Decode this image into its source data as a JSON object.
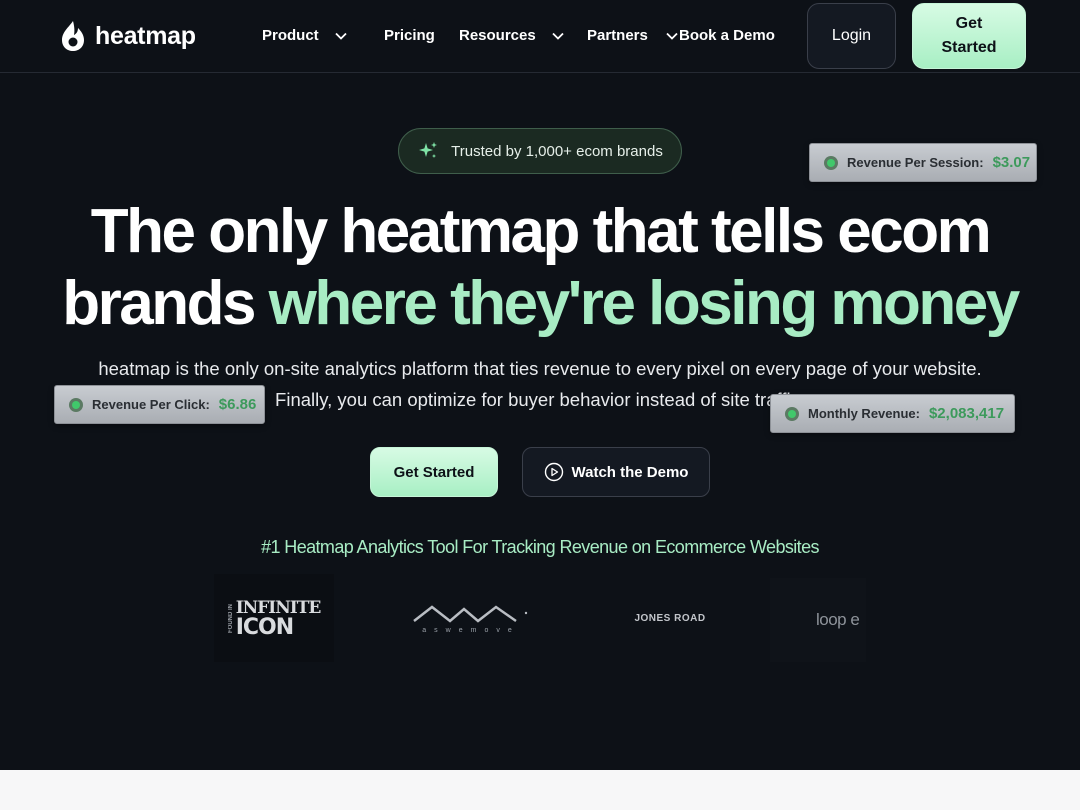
{
  "nav": {
    "brand": "heatmap",
    "items": [
      {
        "label": "Product",
        "has_dropdown": true
      },
      {
        "label": "Pricing",
        "has_dropdown": false
      },
      {
        "label": "Resources",
        "has_dropdown": true
      },
      {
        "label": "Partners",
        "has_dropdown": true
      },
      {
        "label": "Book a Demo",
        "has_dropdown": false
      }
    ],
    "login_label": "Login",
    "get_started_label": "Get Started"
  },
  "hero": {
    "trusted_text": "Trusted by 1,000+ ecom brands",
    "headline_line1": "The only heatmap that tells ecom",
    "headline_line2_plain": "brands",
    "headline_line2_accent": "where they're losing money",
    "subtext_line1": "heatmap is the only on-site analytics platform that ties revenue to every pixel on every page of your website.",
    "subtext_line2": "Finally, you can optimize for buyer behavior instead of site traffic.",
    "cta_primary": "Get Started",
    "cta_secondary": "Watch the Demo",
    "tagline": "#1 Heatmap Analytics Tool For Tracking Revenue on Ecommerce Websites"
  },
  "badges": [
    {
      "label": "Revenue Per Session:",
      "value": "$3.07"
    },
    {
      "label": "Revenue Per Click:",
      "value": "$6.86"
    },
    {
      "label": "Monthly Revenue:",
      "value": "$2,083,417"
    }
  ],
  "logos": {
    "infinite_icon_top": "INFINITE",
    "infinite_icon_bottom": "ICON",
    "infinite_icon_side": "FOUND IN",
    "aswemove": "aswemove",
    "jones_road": "JONES ROAD",
    "loop": "loop e"
  },
  "colors": {
    "background": "#0d1117",
    "accent_green": "#a8ecc4",
    "badge_value": "#3d9a5c",
    "button_gradient_top": "#d7fbe4",
    "button_gradient_bottom": "#a8efc4"
  }
}
